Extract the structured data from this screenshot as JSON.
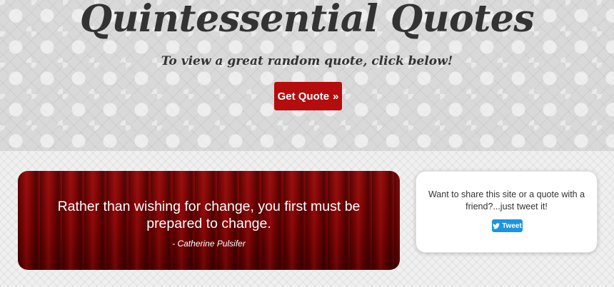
{
  "header": {
    "title": "Quintessential Quotes",
    "subtitle": "To view a great random quote, click below!",
    "get_quote_label": "Get Quote",
    "get_quote_icon": "double-chevron-right-icon",
    "get_quote_glyph": "»"
  },
  "quote": {
    "text": "Rather than wishing for change, you first must be prepared to change.",
    "author": "- Catherine Pulsifer"
  },
  "share": {
    "text": "Want to share this site or a quote with a friend?...just tweet it!",
    "tweet_label": "Tweet",
    "tweet_icon": "twitter-bird-icon"
  },
  "colors": {
    "accent_red": "#b50d0d",
    "tweet_blue": "#1b95e0",
    "text_dark": "#333333"
  }
}
